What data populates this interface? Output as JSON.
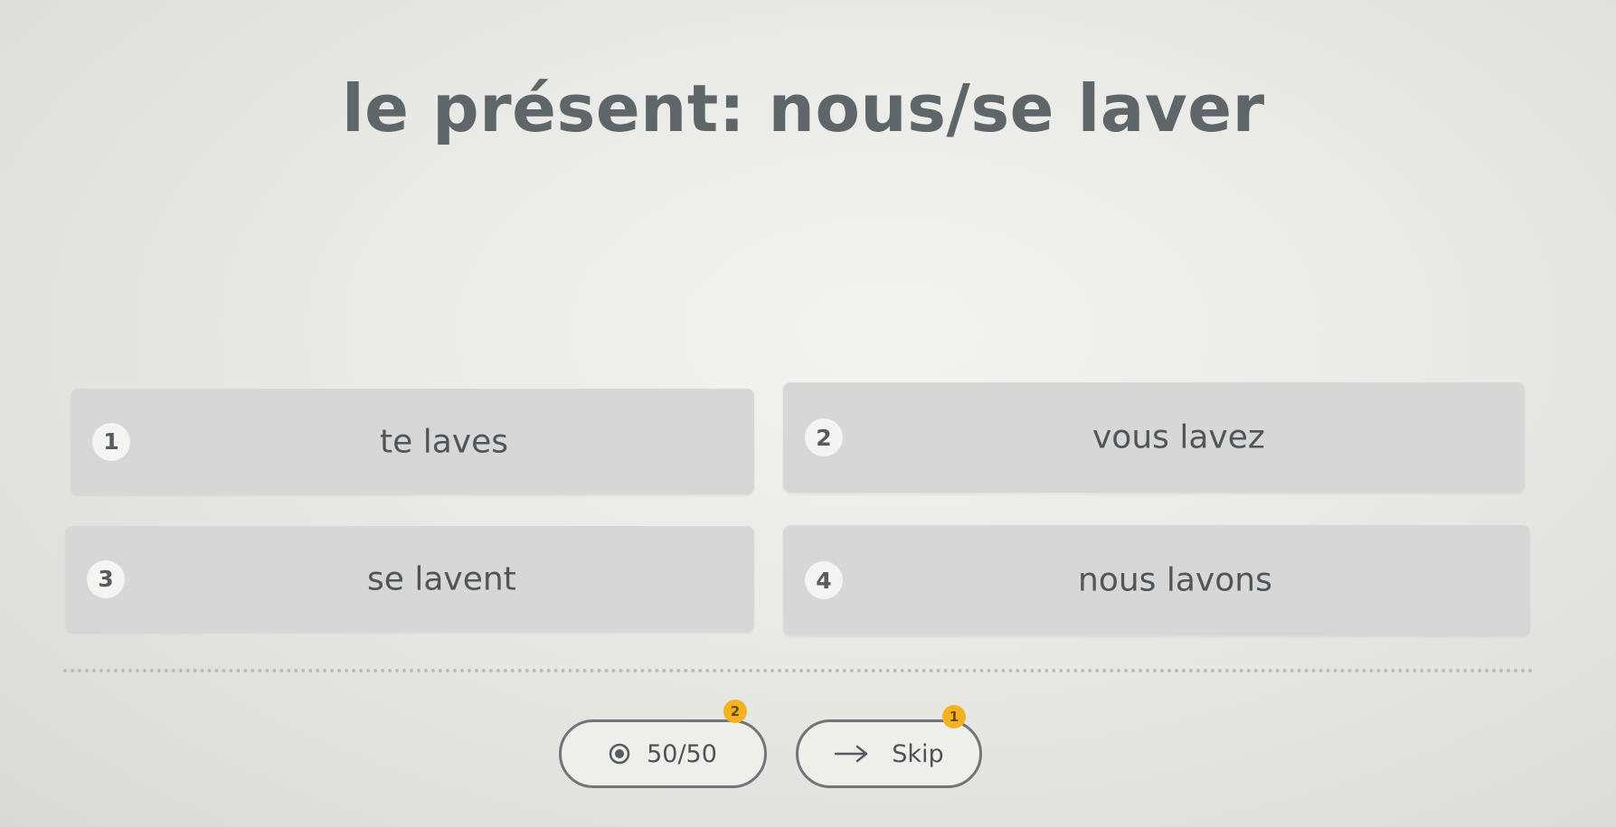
{
  "title": "le présent: nous/se laver",
  "options": [
    {
      "number": "1",
      "label": "te laves"
    },
    {
      "number": "2",
      "label": "vous lavez"
    },
    {
      "number": "3",
      "label": "se lavent"
    },
    {
      "number": "4",
      "label": "nous lavons"
    }
  ],
  "footer": {
    "fifty_fifty": {
      "label": "50/50",
      "count": "2",
      "icon": "fifty-fifty-icon"
    },
    "skip": {
      "label": "Skip",
      "count": "1",
      "icon": "arrow-right-icon"
    }
  },
  "colors": {
    "option_bg": "#d6d7d6",
    "badge_bg": "#f4f4f2",
    "counter_badge": "#f3b321",
    "title_text": "#5f6669"
  }
}
